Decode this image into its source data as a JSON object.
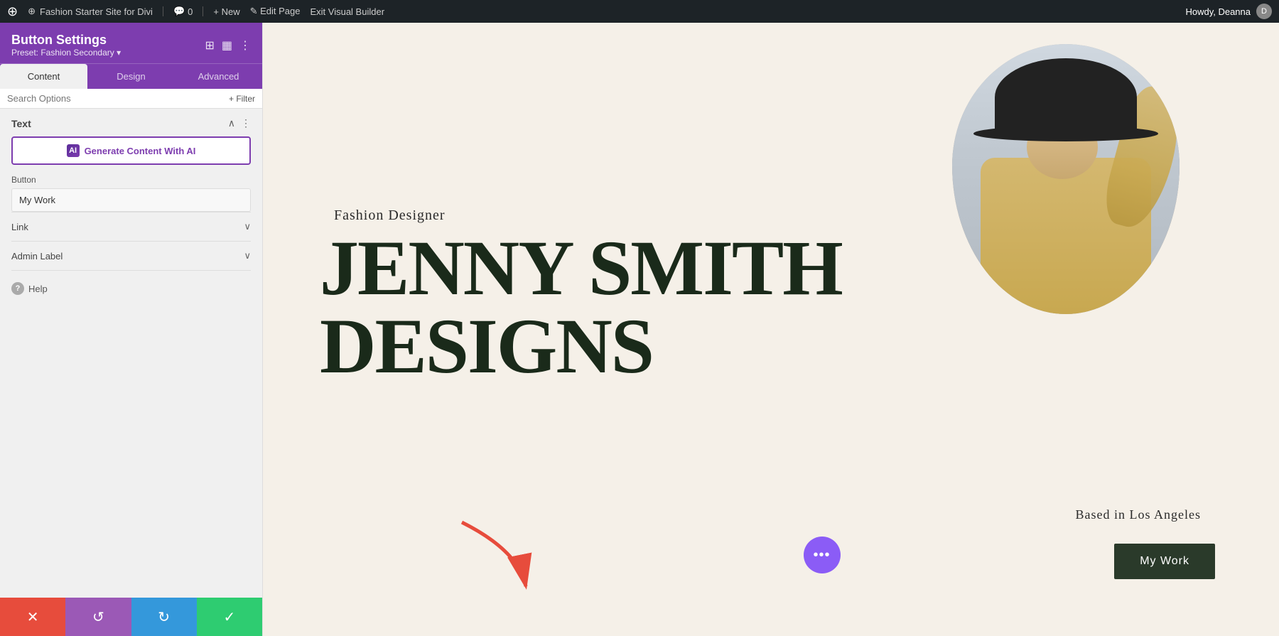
{
  "topbar": {
    "wp_logo": "⊕",
    "site_name": "Fashion Starter Site for Divi",
    "comment_icon": "💬",
    "comment_count": "0",
    "new_label": "+ New",
    "edit_label": "✎ Edit Page",
    "exit_label": "Exit Visual Builder",
    "howdy": "Howdy, Deanna",
    "avatar_initial": "D"
  },
  "panel": {
    "title": "Button Settings",
    "preset_label": "Preset: Fashion Secondary ▾",
    "tabs": [
      "Content",
      "Design",
      "Advanced"
    ],
    "active_tab": "Content",
    "search_placeholder": "Search Options",
    "filter_label": "+ Filter"
  },
  "text_section": {
    "title": "Text",
    "ai_button_label": "Generate Content With AI",
    "ai_icon_text": "AI",
    "button_field_label": "Button",
    "button_field_value": "My Work"
  },
  "link_section": {
    "label": "Link"
  },
  "admin_section": {
    "label": "Admin Label"
  },
  "help": {
    "label": "Help",
    "icon": "?"
  },
  "bottom_bar": {
    "cancel_icon": "✕",
    "undo_icon": "↺",
    "redo_icon": "↻",
    "save_icon": "✓"
  },
  "canvas": {
    "subtitle": "Fashion Designer",
    "title_line1": "JENNY SMITH",
    "title_line2": "DESIGNS",
    "location": "Based in Los Angeles",
    "cta_button": "My Work",
    "dots": "•••"
  },
  "colors": {
    "purple": "#7d3daf",
    "dark_green": "#1a2a1a",
    "cream": "#f5f0e8",
    "cancel_red": "#e74c3c",
    "undo_purple": "#9b59b6",
    "redo_blue": "#3498db",
    "save_green": "#2ecc71"
  }
}
